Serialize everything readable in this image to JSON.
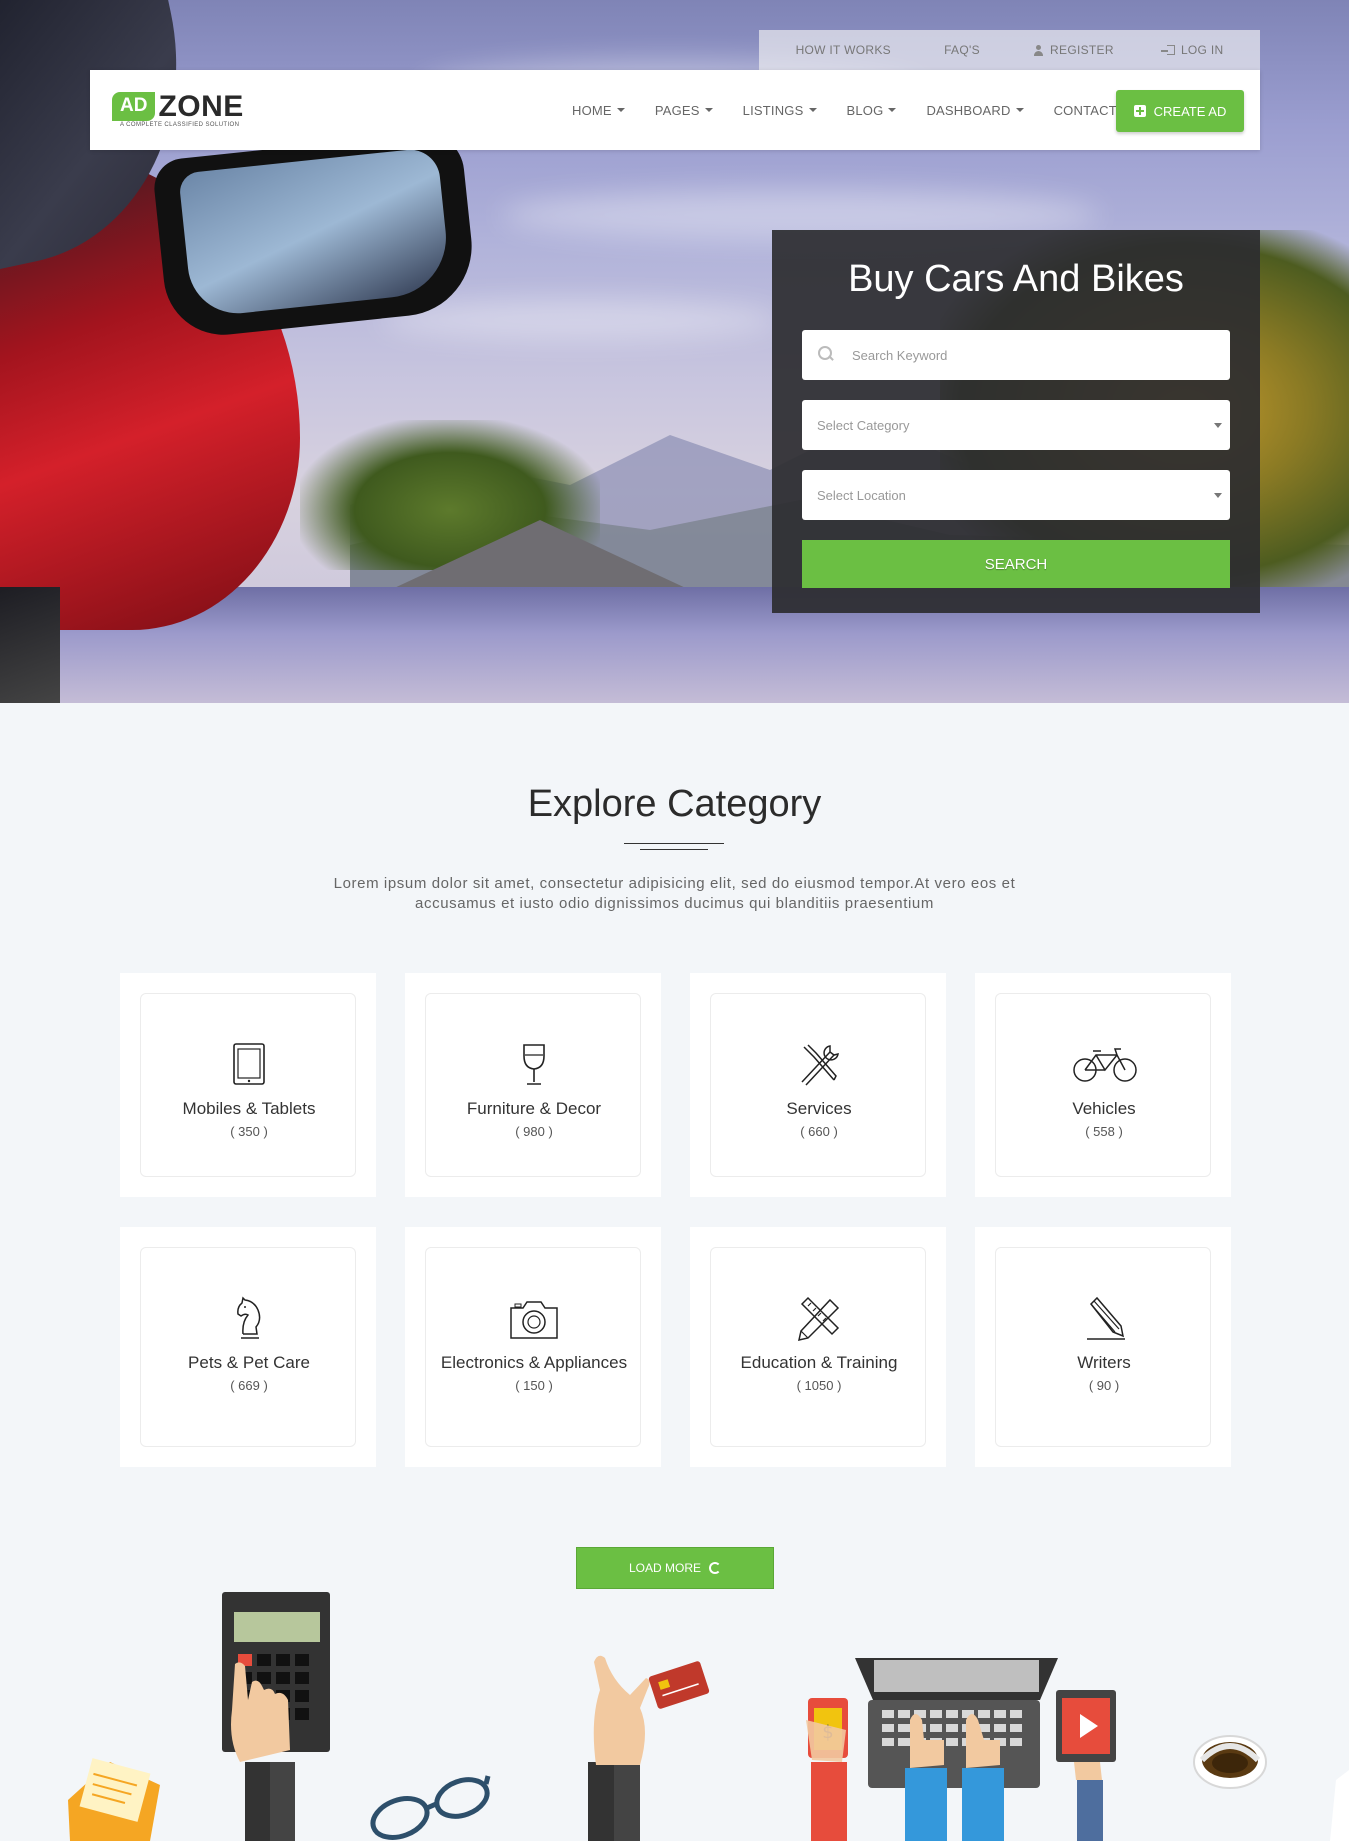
{
  "topbar": {
    "how_it_works": "HOW IT WORKS",
    "faqs": "FAQ'S",
    "register": "REGISTER",
    "login": "LOG IN"
  },
  "logo": {
    "ad": "AD",
    "zone": "ZONE",
    "tagline": "A COMPLETE CLASSIFIED SOLUTION"
  },
  "nav": {
    "home": "HOME",
    "pages": "PAGES",
    "listings": "LISTINGS",
    "blog": "BLOG",
    "dashboard": "DASHBOARD",
    "contact": "CONTACT",
    "create_ad": "CREATE AD"
  },
  "search": {
    "title": "Buy Cars And Bikes",
    "keyword_placeholder": "Search Keyword",
    "category_placeholder": "Select Category",
    "location_placeholder": "Select Location",
    "button": "SEARCH"
  },
  "explore": {
    "title": "Explore Category",
    "description": "Lorem ipsum dolor sit amet, consectetur adipisicing elit, sed do eiusmod tempor.At vero eos et accusamus et iusto odio dignissimos ducimus qui blanditiis praesentium"
  },
  "categories": [
    {
      "name": "Mobiles & Tablets",
      "count": "( 350 )",
      "icon": "tablet-icon"
    },
    {
      "name": "Furniture & Decor",
      "count": "( 980 )",
      "icon": "wine-glass-icon"
    },
    {
      "name": "Services",
      "count": "( 660 )",
      "icon": "tools-icon"
    },
    {
      "name": "Vehicles",
      "count": "( 558 )",
      "icon": "bicycle-icon"
    },
    {
      "name": "Pets & Pet Care",
      "count": "( 669 )",
      "icon": "chess-knight-icon"
    },
    {
      "name": "Electronics & Appliances",
      "count": "( 150 )",
      "icon": "camera-icon"
    },
    {
      "name": "Education & Training",
      "count": "( 1050 )",
      "icon": "pencil-ruler-icon"
    },
    {
      "name": "Writers",
      "count": "( 90 )",
      "icon": "pencil-icon"
    }
  ],
  "load_more": "LOAD MORE",
  "colors": {
    "accent": "#6bbf43",
    "panel": "#2d2d30",
    "background": "#f3f6f9"
  }
}
